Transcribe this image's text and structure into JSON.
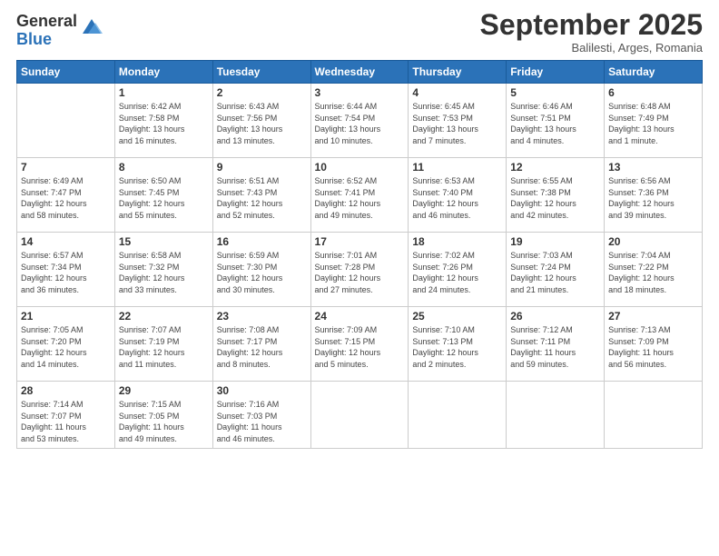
{
  "logo": {
    "general": "General",
    "blue": "Blue"
  },
  "header": {
    "month": "September 2025",
    "location": "Balilesti, Arges, Romania"
  },
  "weekdays": [
    "Sunday",
    "Monday",
    "Tuesday",
    "Wednesday",
    "Thursday",
    "Friday",
    "Saturday"
  ],
  "weeks": [
    [
      {
        "day": "",
        "info": ""
      },
      {
        "day": "1",
        "info": "Sunrise: 6:42 AM\nSunset: 7:58 PM\nDaylight: 13 hours\nand 16 minutes."
      },
      {
        "day": "2",
        "info": "Sunrise: 6:43 AM\nSunset: 7:56 PM\nDaylight: 13 hours\nand 13 minutes."
      },
      {
        "day": "3",
        "info": "Sunrise: 6:44 AM\nSunset: 7:54 PM\nDaylight: 13 hours\nand 10 minutes."
      },
      {
        "day": "4",
        "info": "Sunrise: 6:45 AM\nSunset: 7:53 PM\nDaylight: 13 hours\nand 7 minutes."
      },
      {
        "day": "5",
        "info": "Sunrise: 6:46 AM\nSunset: 7:51 PM\nDaylight: 13 hours\nand 4 minutes."
      },
      {
        "day": "6",
        "info": "Sunrise: 6:48 AM\nSunset: 7:49 PM\nDaylight: 13 hours\nand 1 minute."
      }
    ],
    [
      {
        "day": "7",
        "info": "Sunrise: 6:49 AM\nSunset: 7:47 PM\nDaylight: 12 hours\nand 58 minutes."
      },
      {
        "day": "8",
        "info": "Sunrise: 6:50 AM\nSunset: 7:45 PM\nDaylight: 12 hours\nand 55 minutes."
      },
      {
        "day": "9",
        "info": "Sunrise: 6:51 AM\nSunset: 7:43 PM\nDaylight: 12 hours\nand 52 minutes."
      },
      {
        "day": "10",
        "info": "Sunrise: 6:52 AM\nSunset: 7:41 PM\nDaylight: 12 hours\nand 49 minutes."
      },
      {
        "day": "11",
        "info": "Sunrise: 6:53 AM\nSunset: 7:40 PM\nDaylight: 12 hours\nand 46 minutes."
      },
      {
        "day": "12",
        "info": "Sunrise: 6:55 AM\nSunset: 7:38 PM\nDaylight: 12 hours\nand 42 minutes."
      },
      {
        "day": "13",
        "info": "Sunrise: 6:56 AM\nSunset: 7:36 PM\nDaylight: 12 hours\nand 39 minutes."
      }
    ],
    [
      {
        "day": "14",
        "info": "Sunrise: 6:57 AM\nSunset: 7:34 PM\nDaylight: 12 hours\nand 36 minutes."
      },
      {
        "day": "15",
        "info": "Sunrise: 6:58 AM\nSunset: 7:32 PM\nDaylight: 12 hours\nand 33 minutes."
      },
      {
        "day": "16",
        "info": "Sunrise: 6:59 AM\nSunset: 7:30 PM\nDaylight: 12 hours\nand 30 minutes."
      },
      {
        "day": "17",
        "info": "Sunrise: 7:01 AM\nSunset: 7:28 PM\nDaylight: 12 hours\nand 27 minutes."
      },
      {
        "day": "18",
        "info": "Sunrise: 7:02 AM\nSunset: 7:26 PM\nDaylight: 12 hours\nand 24 minutes."
      },
      {
        "day": "19",
        "info": "Sunrise: 7:03 AM\nSunset: 7:24 PM\nDaylight: 12 hours\nand 21 minutes."
      },
      {
        "day": "20",
        "info": "Sunrise: 7:04 AM\nSunset: 7:22 PM\nDaylight: 12 hours\nand 18 minutes."
      }
    ],
    [
      {
        "day": "21",
        "info": "Sunrise: 7:05 AM\nSunset: 7:20 PM\nDaylight: 12 hours\nand 14 minutes."
      },
      {
        "day": "22",
        "info": "Sunrise: 7:07 AM\nSunset: 7:19 PM\nDaylight: 12 hours\nand 11 minutes."
      },
      {
        "day": "23",
        "info": "Sunrise: 7:08 AM\nSunset: 7:17 PM\nDaylight: 12 hours\nand 8 minutes."
      },
      {
        "day": "24",
        "info": "Sunrise: 7:09 AM\nSunset: 7:15 PM\nDaylight: 12 hours\nand 5 minutes."
      },
      {
        "day": "25",
        "info": "Sunrise: 7:10 AM\nSunset: 7:13 PM\nDaylight: 12 hours\nand 2 minutes."
      },
      {
        "day": "26",
        "info": "Sunrise: 7:12 AM\nSunset: 7:11 PM\nDaylight: 11 hours\nand 59 minutes."
      },
      {
        "day": "27",
        "info": "Sunrise: 7:13 AM\nSunset: 7:09 PM\nDaylight: 11 hours\nand 56 minutes."
      }
    ],
    [
      {
        "day": "28",
        "info": "Sunrise: 7:14 AM\nSunset: 7:07 PM\nDaylight: 11 hours\nand 53 minutes."
      },
      {
        "day": "29",
        "info": "Sunrise: 7:15 AM\nSunset: 7:05 PM\nDaylight: 11 hours\nand 49 minutes."
      },
      {
        "day": "30",
        "info": "Sunrise: 7:16 AM\nSunset: 7:03 PM\nDaylight: 11 hours\nand 46 minutes."
      },
      {
        "day": "",
        "info": ""
      },
      {
        "day": "",
        "info": ""
      },
      {
        "day": "",
        "info": ""
      },
      {
        "day": "",
        "info": ""
      }
    ]
  ]
}
